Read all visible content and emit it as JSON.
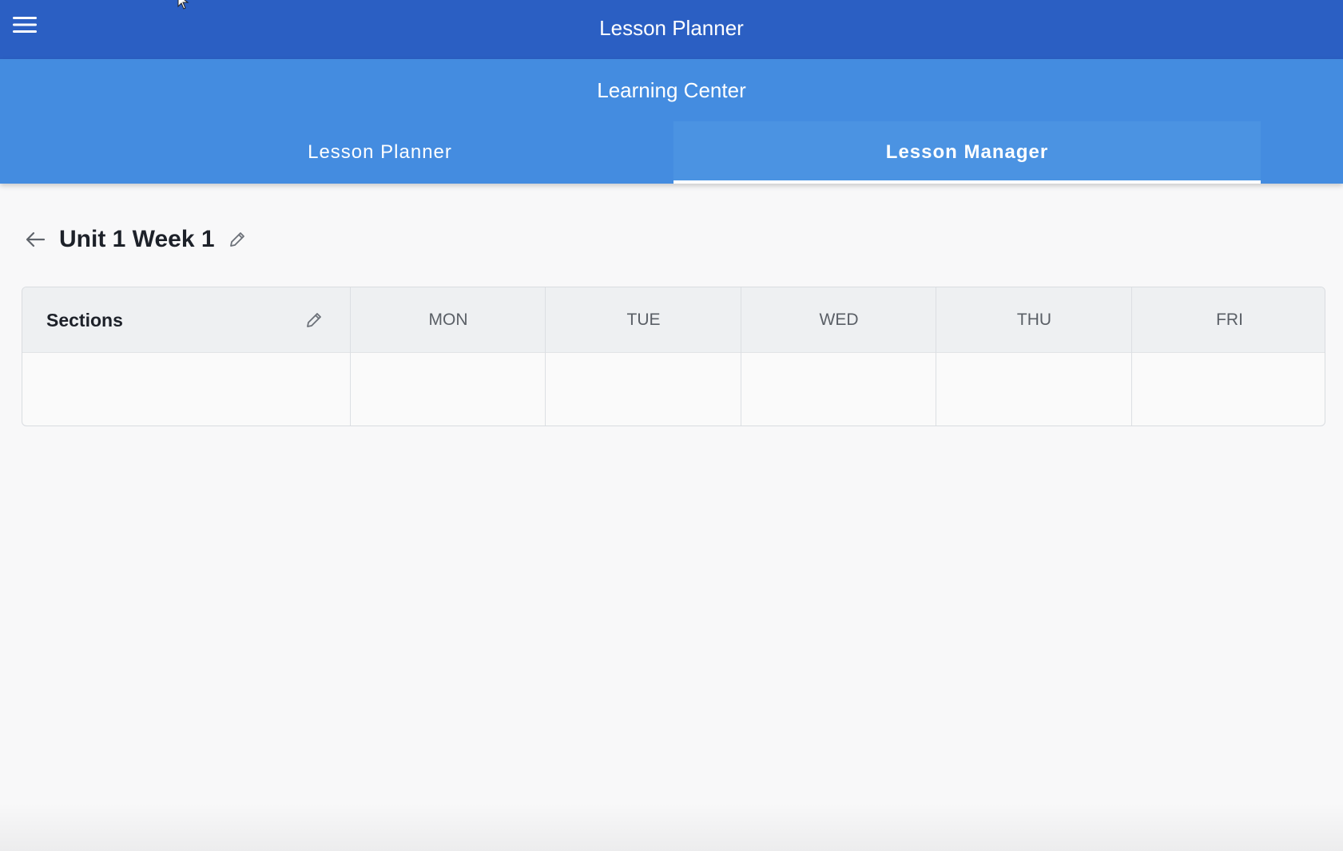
{
  "app_bar": {
    "title": "Lesson Planner",
    "menu_icon": "hamburger-menu-icon",
    "background": "#2b5fc3"
  },
  "sub_header": {
    "title": "Learning Center",
    "background": "#448ce0",
    "tabs": [
      {
        "label": "Lesson Planner",
        "active": false
      },
      {
        "label": "Lesson Manager",
        "active": true
      }
    ]
  },
  "page": {
    "title": "Unit 1 Week 1",
    "back_icon": "arrow-left-icon",
    "edit_icon": "pencil-icon"
  },
  "schedule": {
    "sections_header": "Sections",
    "sections_edit_icon": "pencil-icon",
    "days": [
      "MON",
      "TUE",
      "WED",
      "THU",
      "FRI"
    ]
  }
}
